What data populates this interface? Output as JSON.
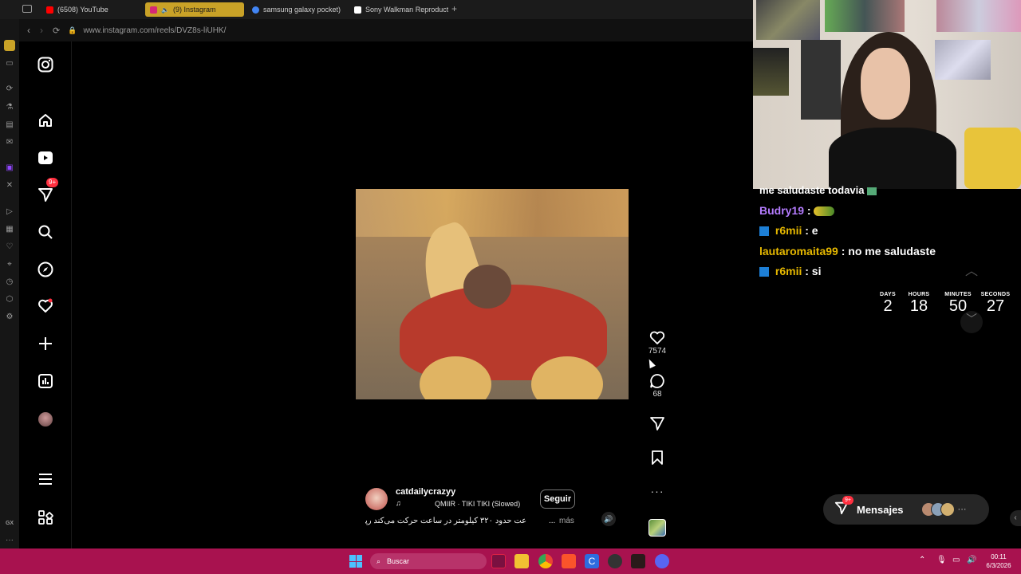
{
  "browser": {
    "tabs": [
      {
        "label": "(6508) YouTube",
        "color": "#ff0000"
      },
      {
        "label": "(9) Instagram",
        "color": "#d62976",
        "active": true
      },
      {
        "label": "samsung galaxy pocket)",
        "color": "#4285f4"
      },
      {
        "label": "Sony Walkman Reproduct",
        "color": "#ffffff"
      }
    ],
    "new_tab": "+",
    "url": "www.instagram.com/reels/DVZ8s-liUHK/",
    "sidebar_label": "GX"
  },
  "instagram": {
    "nav_badge": "9+",
    "author": "catdailycrazyy",
    "song": "QMIIR · TIKI TIKI (Slowed)",
    "follow": "Seguir",
    "caption": "عت حدود ۳۲۰ کیلومتر در ساعت حرکت می‌کند ﺭﭘ",
    "caption_ellipsis": "...",
    "more": "más",
    "likes": "7574",
    "comments": "68",
    "more_actions": "···",
    "messages_label": "Mensajes",
    "messages_badge": "9+",
    "messages_more": "···"
  },
  "chat": {
    "messages": [
      {
        "user": "",
        "text": "me saludaste todavia",
        "color": "#ffffff"
      },
      {
        "user": "Budry19",
        "text": ":",
        "color": "#b57cff"
      },
      {
        "user": "r6mii",
        "text": ": e",
        "color": "#e6b800"
      },
      {
        "user": "lautaromaita99",
        "text": ": no me saludaste",
        "color": "#e6b800"
      },
      {
        "user": "r6mii",
        "text": ": si",
        "color": "#e6b800"
      }
    ]
  },
  "countdown": {
    "days_label": "DAYS",
    "days": "2",
    "hours_label": "HOURS",
    "hours": "18",
    "minutes_label": "MINUTES",
    "minutes": "50",
    "seconds_label": "SECONDS",
    "seconds": "27"
  },
  "taskbar": {
    "search_placeholder": "Buscar",
    "time": "00:11",
    "date": "6/3/2026"
  }
}
